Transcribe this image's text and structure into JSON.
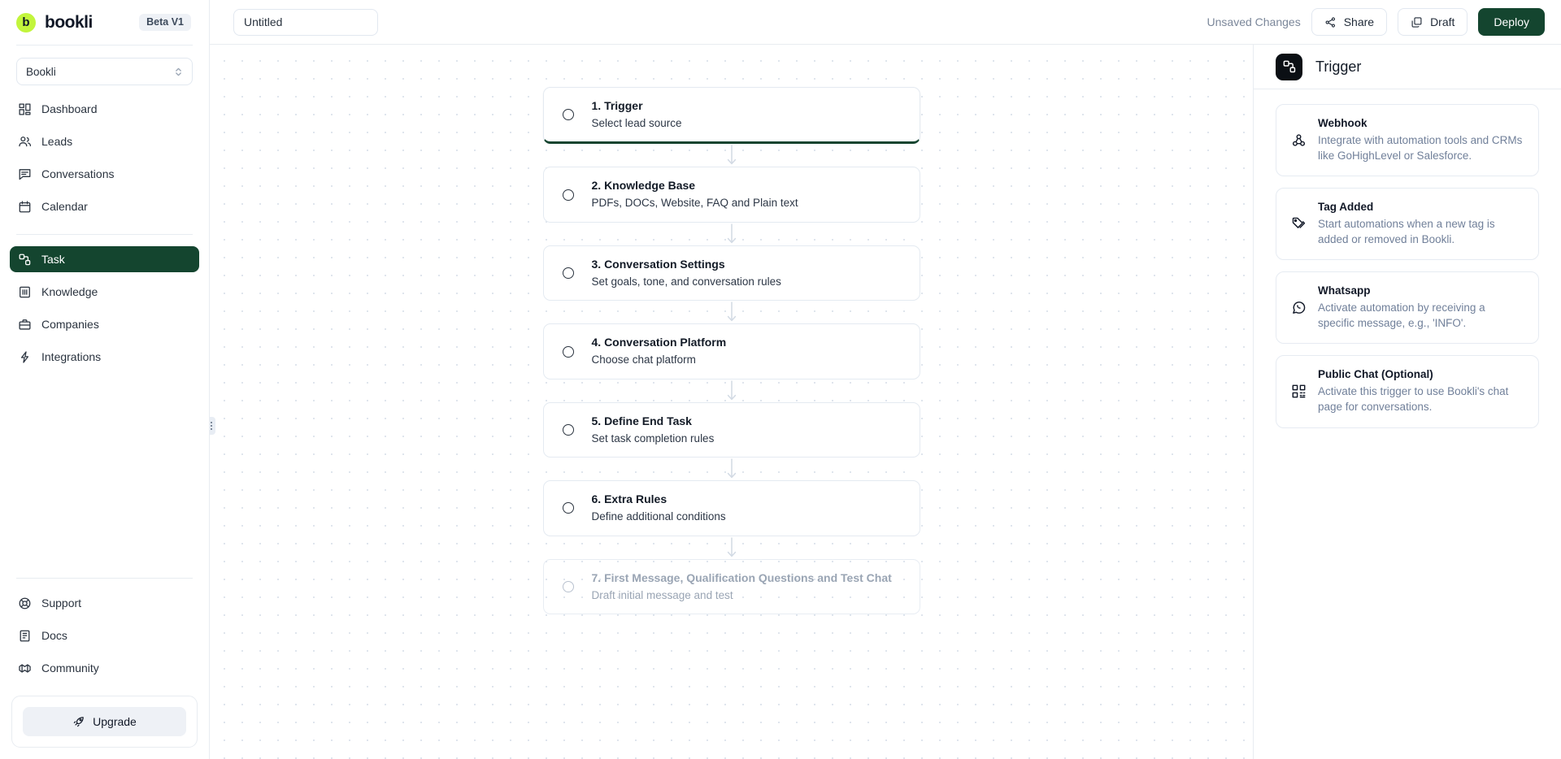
{
  "brand": {
    "logo_letter": "b",
    "name": "bookli",
    "badge": "Beta V1",
    "accent_lime": "#c2f53c",
    "accent_green": "#14452f"
  },
  "workspace": {
    "selected": "Bookli",
    "icon": "chevron-updown-icon"
  },
  "sidebar": {
    "primary_items": [
      {
        "label": "Dashboard",
        "icon": "dashboard-icon",
        "active": false
      },
      {
        "label": "Leads",
        "icon": "users-icon",
        "active": false
      },
      {
        "label": "Conversations",
        "icon": "chat-icon",
        "active": false
      },
      {
        "label": "Calendar",
        "icon": "calendar-icon",
        "active": false
      }
    ],
    "secondary_items": [
      {
        "label": "Task",
        "icon": "flow-node-icon",
        "active": true
      },
      {
        "label": "Knowledge",
        "icon": "book-icon",
        "active": false
      },
      {
        "label": "Companies",
        "icon": "briefcase-icon",
        "active": false
      },
      {
        "label": "Integrations",
        "icon": "lightning-icon",
        "active": false
      }
    ],
    "footer_items": [
      {
        "label": "Support",
        "icon": "lifebuoy-icon"
      },
      {
        "label": "Docs",
        "icon": "document-icon"
      },
      {
        "label": "Community",
        "icon": "handshake-icon"
      }
    ],
    "upgrade_label": "Upgrade",
    "upgrade_icon": "rocket-icon"
  },
  "topbar": {
    "title_value": "Untitled",
    "title_placeholder": "Untitled",
    "unsaved_label": "Unsaved Changes",
    "share_label": "Share",
    "share_icon": "share-network-icon",
    "draft_label": "Draft",
    "draft_icon": "copy-icon",
    "deploy_label": "Deploy"
  },
  "flow": {
    "steps": [
      {
        "title": "1. Trigger",
        "subtitle": "Select lead source",
        "active": true,
        "disabled": false
      },
      {
        "title": "2. Knowledge Base",
        "subtitle": "PDFs, DOCs, Website, FAQ and Plain text",
        "active": false,
        "disabled": false
      },
      {
        "title": "3. Conversation Settings",
        "subtitle": "Set goals, tone, and conversation rules",
        "active": false,
        "disabled": false
      },
      {
        "title": "4. Conversation Platform",
        "subtitle": "Choose chat platform",
        "active": false,
        "disabled": false
      },
      {
        "title": "5. Define End Task",
        "subtitle": "Set task completion rules",
        "active": false,
        "disabled": false
      },
      {
        "title": "6. Extra Rules",
        "subtitle": "Define additional conditions",
        "active": false,
        "disabled": false
      },
      {
        "title": "7. First Message, Qualification Questions and Test Chat",
        "subtitle": "Draft initial message and test",
        "active": false,
        "disabled": true
      }
    ]
  },
  "right_panel": {
    "title": "Trigger",
    "badge_icon": "flow-node-icon",
    "options": [
      {
        "title": "Webhook",
        "desc": "Integrate with automation tools and CRMs like GoHighLevel or Salesforce.",
        "icon": "webhook-icon"
      },
      {
        "title": "Tag Added",
        "desc": "Start automations when a new tag is added or removed in Bookli.",
        "icon": "tag-icon"
      },
      {
        "title": "Whatsapp",
        "desc": "Activate automation by receiving a specific message, e.g., 'INFO'.",
        "icon": "whatsapp-icon"
      },
      {
        "title": "Public Chat (Optional)",
        "desc": "Activate this trigger to use Bookli's chat page for conversations.",
        "icon": "qr-code-icon"
      }
    ]
  }
}
